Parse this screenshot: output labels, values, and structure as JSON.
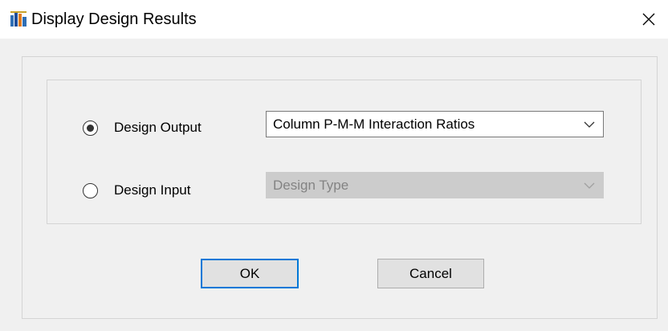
{
  "window": {
    "title": "Display Design Results",
    "icon": "etabs-app-icon",
    "close_icon": "close-icon"
  },
  "options": {
    "design_output": {
      "label": "Design Output",
      "selected": true,
      "combo_value": "Column P-M-M Interaction Ratios",
      "combo_enabled": true
    },
    "design_input": {
      "label": "Design Input",
      "selected": false,
      "combo_value": "Design Type",
      "combo_enabled": false
    }
  },
  "buttons": {
    "ok_label": "OK",
    "cancel_label": "Cancel"
  },
  "colors": {
    "accent": "#0078d7",
    "client_bg": "#f0f0f0",
    "disabled_bg": "#cccccc",
    "disabled_text": "#838383"
  }
}
